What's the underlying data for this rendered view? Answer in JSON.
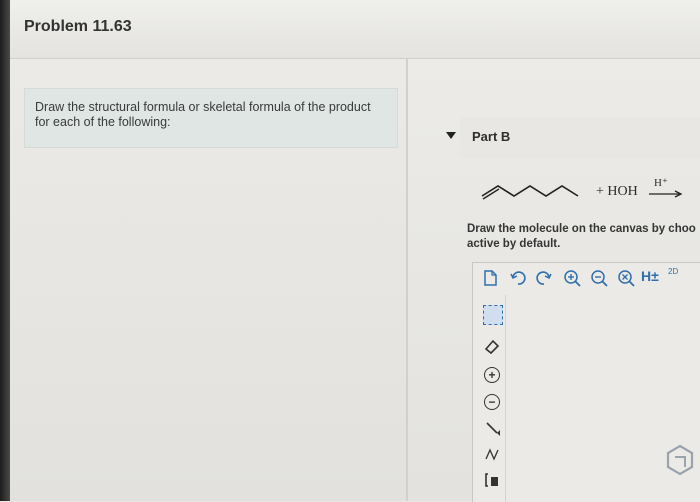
{
  "header": {
    "title": "Problem 11.63"
  },
  "instruction": {
    "text": "Draw the structural formula or skeletal formula of the product for each of the following:"
  },
  "part": {
    "label": "Part B"
  },
  "reaction": {
    "reagent": "+ HOH",
    "catalyst": "H⁺"
  },
  "canvas": {
    "instruction_text": "Draw the molecule on the canvas by choo",
    "instruction_text_2": "active by default.",
    "toolbar": {
      "h_label": "H±",
      "label_2d": "2D"
    }
  }
}
